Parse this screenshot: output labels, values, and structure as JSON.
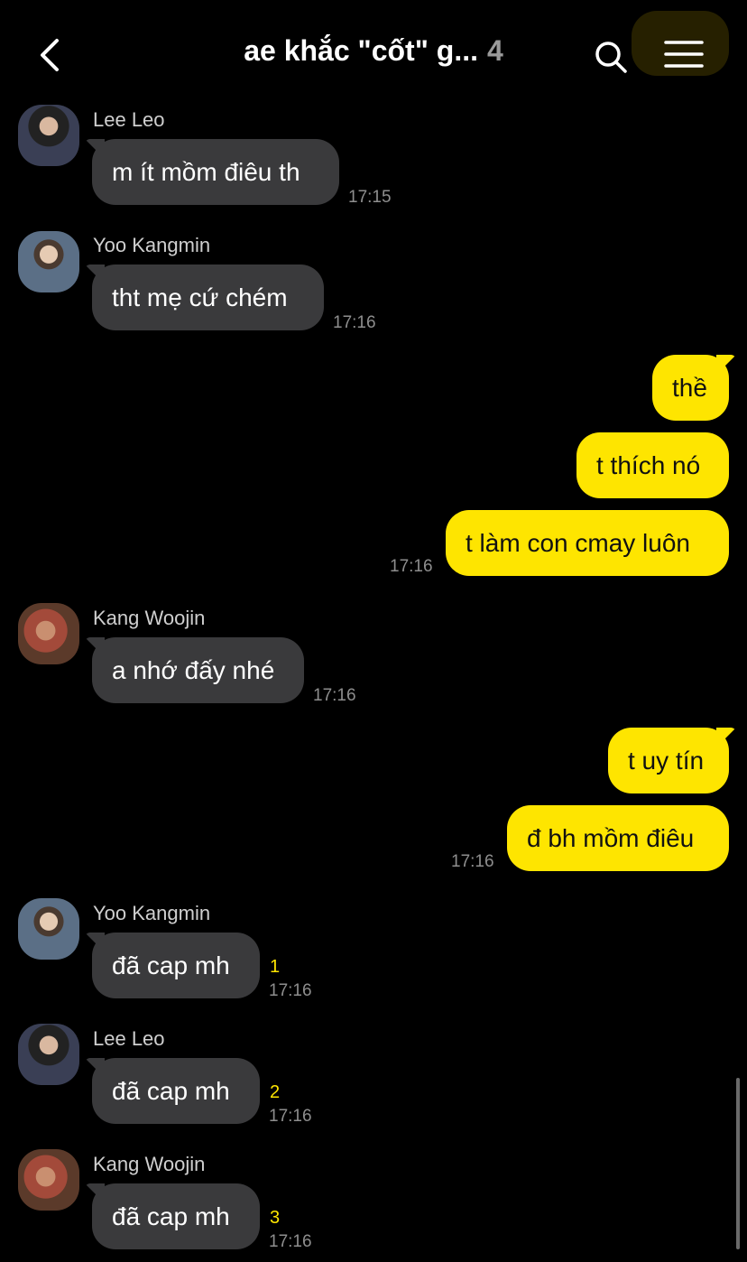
{
  "header": {
    "back_icon": "chevron-left-icon",
    "title": "ae khắc \"cốt\" g...",
    "member_count": "4",
    "search_icon": "search-icon",
    "menu_icon": "hamburger-menu-icon"
  },
  "colors": {
    "incoming_bubble": "#3a3a3c",
    "outgoing_bubble": "#fee500",
    "unread_count": "#fee500",
    "background": "#000000"
  },
  "messages": [
    {
      "sender": "Lee Leo",
      "text": "m ít mồm điêu th",
      "time": "17:15"
    },
    {
      "sender": "Yoo Kangmin",
      "text": "tht mẹ cứ chém",
      "time": "17:16"
    },
    {
      "text": "thề"
    },
    {
      "text": "t thích nó"
    },
    {
      "text": "t làm con cmay luôn",
      "time": "17:16"
    },
    {
      "sender": "Kang Woojin",
      "text": "a nhớ đấy nhé",
      "time": "17:16"
    },
    {
      "text": "t uy tín"
    },
    {
      "text": "đ bh mồm điêu",
      "time": "17:16"
    },
    {
      "sender": "Yoo Kangmin",
      "text": "đã cap mh",
      "unread": "1",
      "time": "17:16"
    },
    {
      "sender": "Lee Leo",
      "text": "đã cap mh",
      "unread": "2",
      "time": "17:16"
    },
    {
      "sender": "Kang Woojin",
      "text": "đã cap mh",
      "unread": "3",
      "time": "17:16"
    }
  ]
}
